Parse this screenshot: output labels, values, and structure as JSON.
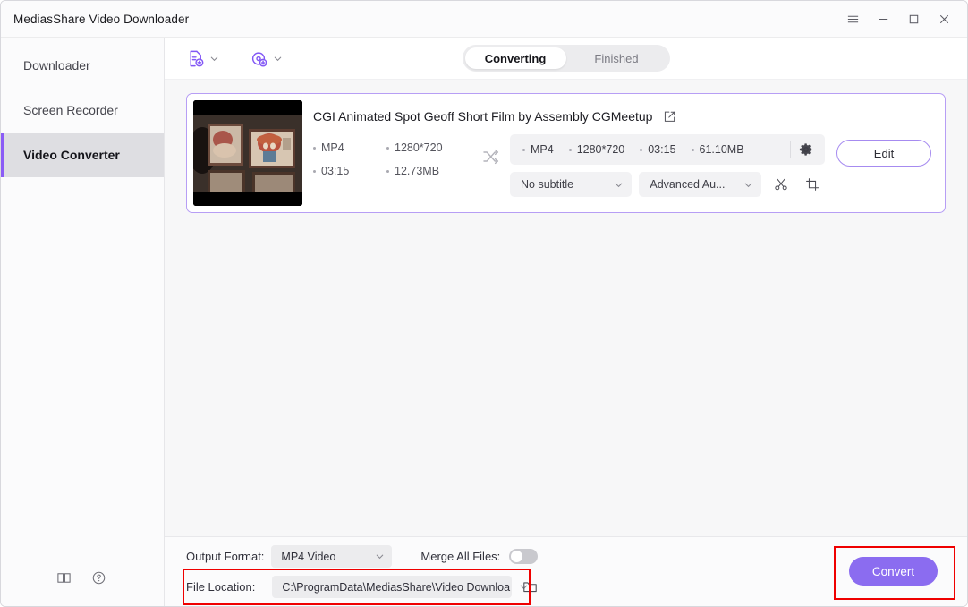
{
  "window": {
    "title": "MediasShare Video Downloader",
    "controls": [
      {
        "name": "menu-icon",
        "glyph": "menu"
      },
      {
        "name": "minimize-icon",
        "glyph": "minimize"
      },
      {
        "name": "maximize-icon",
        "glyph": "maximize"
      },
      {
        "name": "close-icon",
        "glyph": "close"
      }
    ]
  },
  "sidebar": {
    "items": [
      {
        "label": "Downloader",
        "active": false
      },
      {
        "label": "Screen Recorder",
        "active": false
      },
      {
        "label": "Video Converter",
        "active": true
      }
    ],
    "bottom_icons": [
      {
        "name": "guide-book-icon"
      },
      {
        "name": "help-icon"
      }
    ]
  },
  "toolbar": {
    "add_file_icon": "add-file-icon",
    "add_disc_icon": "add-disc-icon",
    "tabs": [
      {
        "label": "Converting",
        "active": true
      },
      {
        "label": "Finished",
        "active": false
      }
    ]
  },
  "task": {
    "title": "CGI Animated Spot Geoff Short Film by Assembly  CGMeetup",
    "edit_title_icon": "edit-icon",
    "source": {
      "format": "MP4",
      "resolution": "1280*720",
      "duration": "03:15",
      "size": "12.73MB"
    },
    "swap_icon": "shuffle-icon",
    "output": {
      "format": "MP4",
      "resolution": "1280*720",
      "duration": "03:15",
      "size": "61.10MB",
      "settings_icon": "gear-icon"
    },
    "subtitle_select": "No subtitle",
    "audio_select": "Advanced Au...",
    "trim_icon": "scissors-icon",
    "crop_icon": "crop-icon",
    "edit_button": "Edit"
  },
  "bottom": {
    "output_format_label": "Output Format:",
    "output_format_value": "MP4 Video",
    "merge_label": "Merge All Files:",
    "merge_enabled": false,
    "file_location_label": "File Location:",
    "file_location_value": "C:\\ProgramData\\MediasShare\\Video Downloa",
    "folder_icon": "folder-icon",
    "convert_button": "Convert"
  },
  "colors": {
    "accent": "#8b5cf6",
    "convert_button": "#8b6cf0",
    "card_border": "#b79ef5",
    "annotation": "#ef0000"
  }
}
